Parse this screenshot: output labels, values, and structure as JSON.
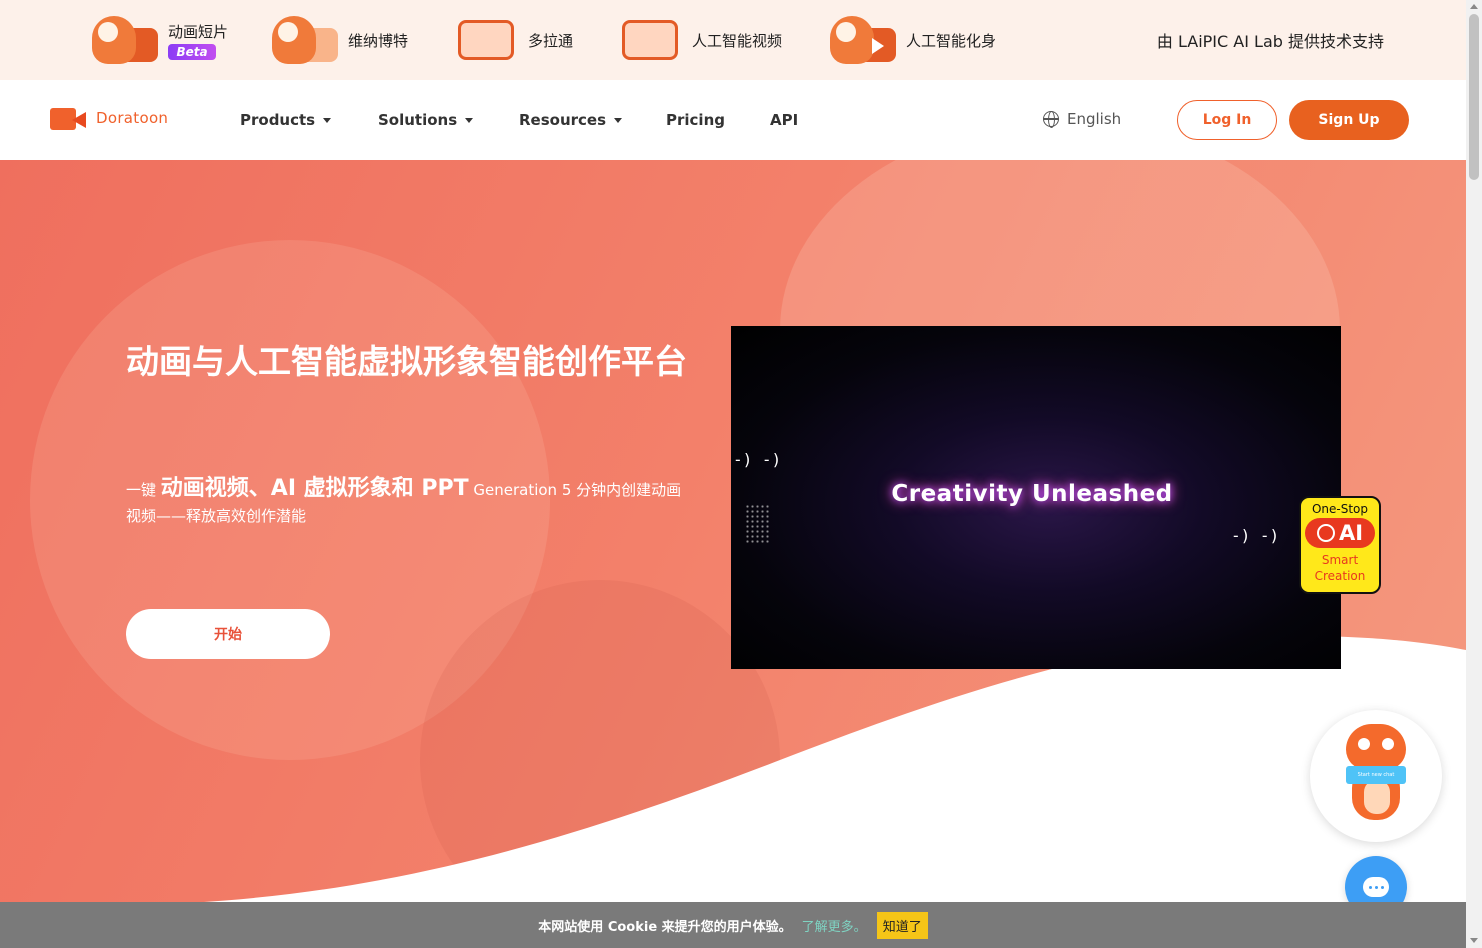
{
  "promo": {
    "items": [
      {
        "label": "动画短片",
        "badge": "Beta"
      },
      {
        "label": "维纳博特"
      },
      {
        "label": "多拉通"
      },
      {
        "label": "人工智能视频"
      },
      {
        "label": "人工智能化身"
      }
    ],
    "powered_by": "由 LAiPIC AI Lab 提供技术支持"
  },
  "nav": {
    "logo_text": "Doratoon",
    "items": [
      "Products",
      "Solutions",
      "Resources",
      "Pricing",
      "API"
    ],
    "language": "English",
    "login": "Log In",
    "signup": "Sign Up"
  },
  "hero": {
    "title": "动画与人工智能虚拟形象智能创作平台",
    "sub_prefix": "一键",
    "sub_highlight": "动画视频、AI 虚拟形象和 PPT",
    "sub_suffix": "Generation 5 分钟内创建动画视频——释放高效创作潜能",
    "start_button": "开始"
  },
  "video": {
    "text": "Creativity Unleashed",
    "arrows_left": "-) -)",
    "arrows_right": "-) -)"
  },
  "badge": {
    "top": "One-Stop",
    "ai": "AI",
    "bottom1": "Smart",
    "bottom2": "Creation"
  },
  "mascot": {
    "sign": "Start new chat"
  },
  "cookie": {
    "message": "本网站使用 Cookie 来提升您的用户体验。",
    "link": "了解更多。",
    "button": "知道了"
  },
  "colors": {
    "accent": "#e8611f",
    "hero_bg": "#f3806a",
    "promo_bg": "#fdf1ea",
    "cookie_bg": "#7a7a7a",
    "cookie_btn": "#f5c518",
    "chat": "#3d9ef5"
  }
}
